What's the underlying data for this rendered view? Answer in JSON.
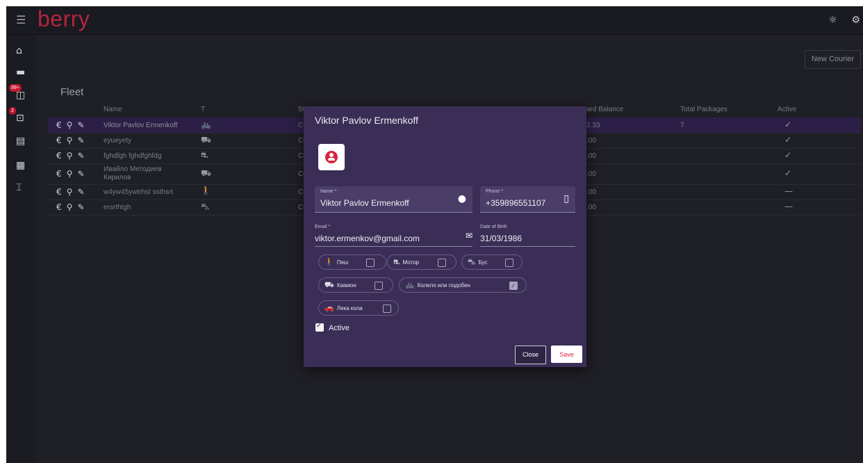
{
  "header": {
    "logo": "berry",
    "menu_icon": "hamburger-menu-icon",
    "right_icons": [
      "lightbulb-icon",
      "gear-icon"
    ]
  },
  "sidebar": {
    "items": [
      {
        "icon": "home-icon"
      },
      {
        "icon": "truck-icon"
      },
      {
        "icon": "package-icon",
        "badge": "99+"
      },
      {
        "icon": "inbox-download-icon",
        "badge": "2"
      },
      {
        "icon": "store-icon"
      },
      {
        "icon": "document-icon"
      },
      {
        "icon": "bank-icon"
      }
    ]
  },
  "main": {
    "new_courier": "New Courier",
    "title": "Fleet",
    "columns": [
      "Name",
      "T",
      "St",
      "ard Balance",
      "Total Packages",
      "Active"
    ],
    "rows": [
      {
        "name": "Viktor Pavlov Ermenkoff",
        "types": "bike-scooter",
        "status": "Co",
        "balance": "2.33",
        "packages": "7",
        "active": "✓"
      },
      {
        "name": "eyueyety",
        "types": "truck",
        "status": "Co",
        "balance": ".00",
        "packages": "",
        "active": "✓"
      },
      {
        "name": "fghdfgh fghdfghfdg",
        "types": "moto",
        "status": "Co",
        "balance": ".00",
        "packages": "",
        "active": "✓"
      },
      {
        "name": "Ивайло Методиев Кирилов",
        "types": "truck",
        "status": "Co",
        "balance": ".00",
        "packages": "",
        "active": "✓"
      },
      {
        "name": "w4yw45ywtrhst ssthsrt",
        "types": "walk",
        "status": "Co",
        "balance": ".00",
        "packages": "",
        "active": "—"
      },
      {
        "name": "ersrthtgh",
        "types": "van",
        "status": "Co",
        "balance": ".00",
        "packages": "",
        "active": "—"
      }
    ]
  },
  "modal": {
    "title": "Viktor Pavlov Ermenkoff",
    "name_label": "Name *",
    "name_value": "Viktor Pavlov Ermenkoff",
    "phone_label": "Phone *",
    "phone_value": "+359896551107",
    "email_label": "Email *",
    "email_value": "viktor.ermenkov@gmail.com",
    "dob_label": "Date of Birth",
    "dob_value": "31/03/1986",
    "vehicles": [
      {
        "label": "Пеш",
        "icon": "walk-icon",
        "checked": false
      },
      {
        "label": "Мотор",
        "icon": "moto-icon",
        "checked": false
      },
      {
        "label": "Бус",
        "icon": "van-icon",
        "checked": false
      },
      {
        "label": "Камион",
        "icon": "truck-icon",
        "checked": false
      },
      {
        "label": "Колело или подобен",
        "icon": "bike-scooter-icon",
        "checked": true
      },
      {
        "label": "Лека кола",
        "icon": "car-icon",
        "checked": false
      }
    ],
    "active_label": "Active",
    "close_label": "Close",
    "save_label": "Save"
  },
  "colors": {
    "accent": "#d62b43",
    "modal_bg": "#3a2d56",
    "selected_row": "#2c1f47",
    "page_bg": "#1f1f26"
  }
}
